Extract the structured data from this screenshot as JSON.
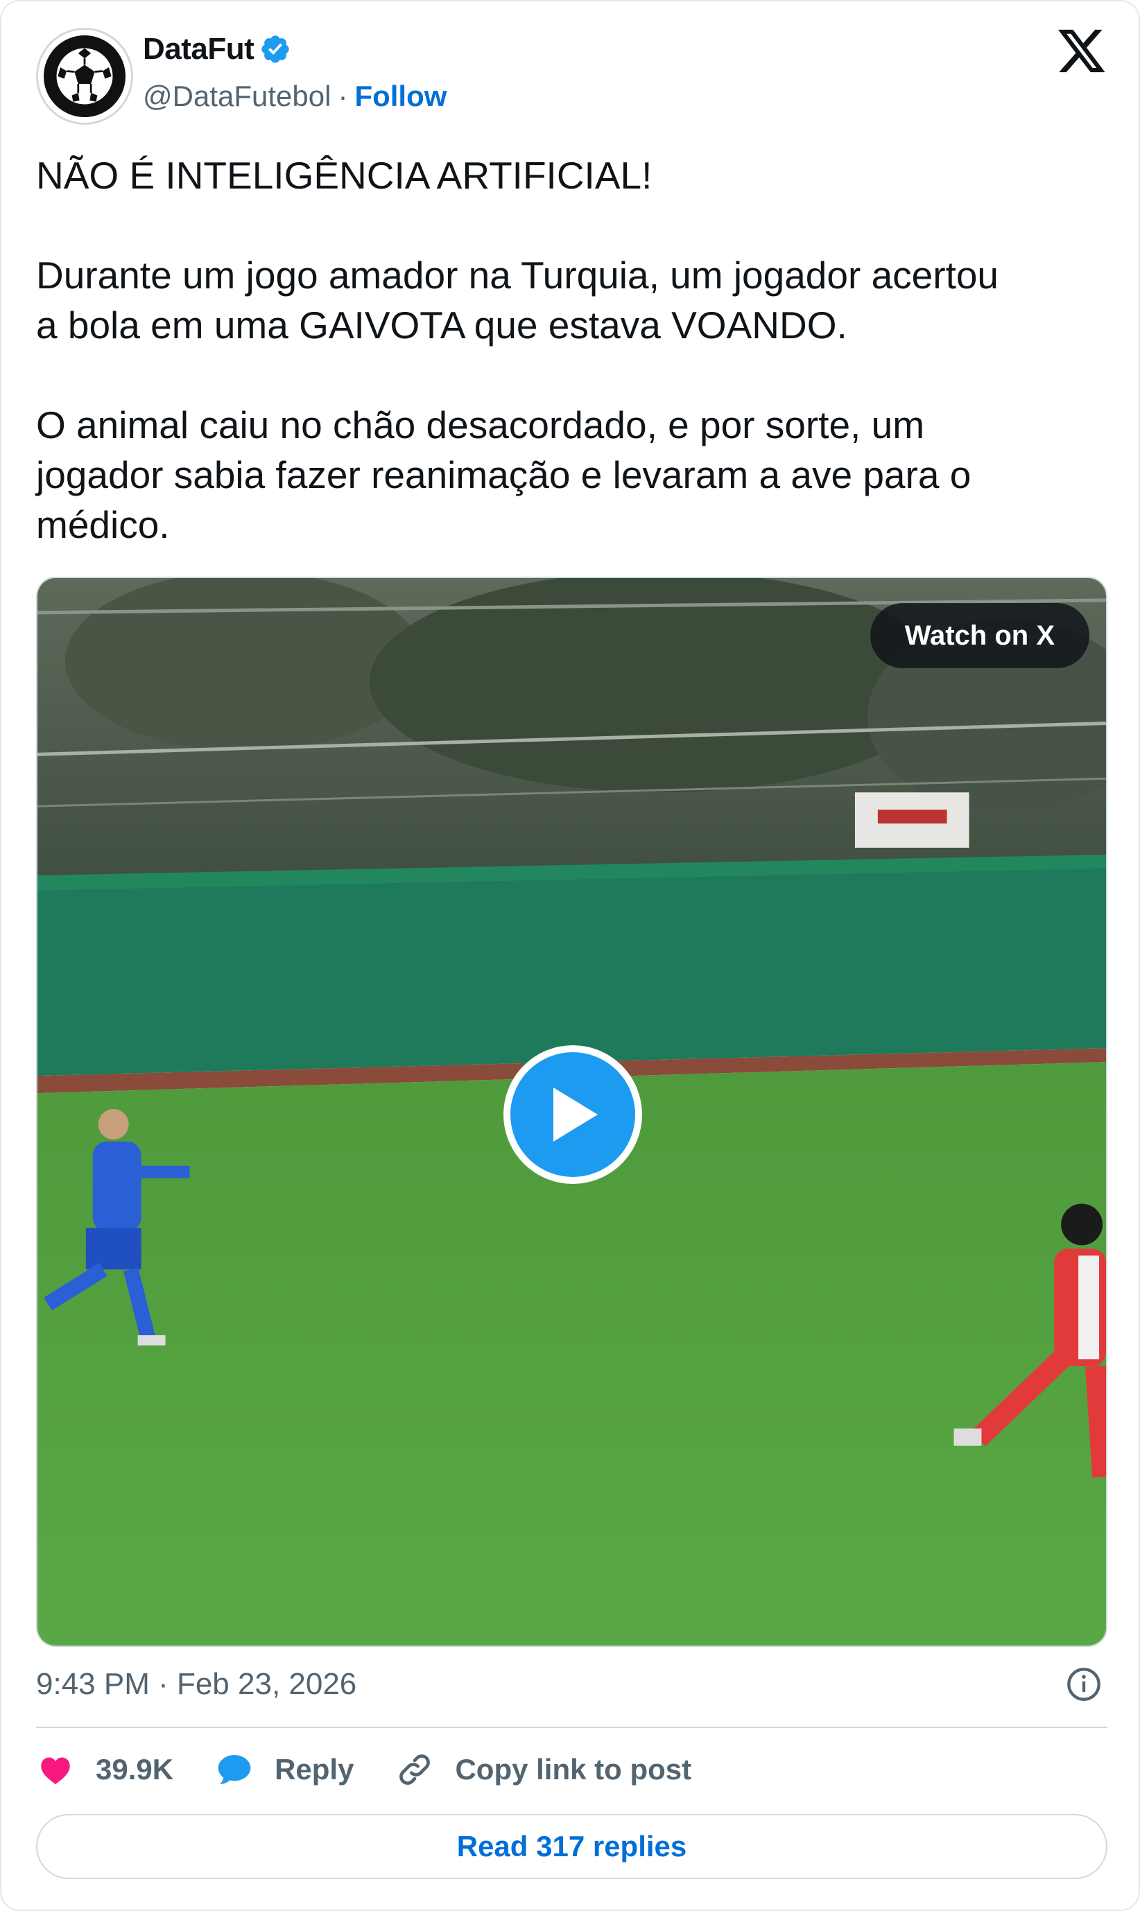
{
  "author": {
    "display_name": "DataFut",
    "handle": "@DataFutebol",
    "separator": "·",
    "follow_label": "Follow"
  },
  "tweet": {
    "text": "NÃO É INTELIGÊNCIA ARTIFICIAL!\n\nDurante um jogo amador na Turquia, um jogador acertou\na bola em uma GAIVOTA que estava VOANDO.\n\nO animal caiu no chão desacordado, e por sorte, um\njogador sabia fazer reanimação e levaram a ave para o\nmédico."
  },
  "media": {
    "watch_label": "Watch on X"
  },
  "meta": {
    "timestamp": "9:43 PM · Feb 23, 2026"
  },
  "actions": {
    "likes": "39.9K",
    "reply_label": "Reply",
    "copy_label": "Copy link to post"
  },
  "footer": {
    "read_replies_label": "Read 317 replies"
  },
  "colors": {
    "link_blue": "#006fd6",
    "verified_blue": "#1d9bf0",
    "like_pink": "#f91880",
    "muted_text": "#536471"
  },
  "icons": [
    "soccer-ball-icon",
    "verified-badge-icon",
    "x-logo-icon",
    "play-icon",
    "info-icon",
    "heart-icon",
    "reply-bubble-icon",
    "link-icon"
  ]
}
